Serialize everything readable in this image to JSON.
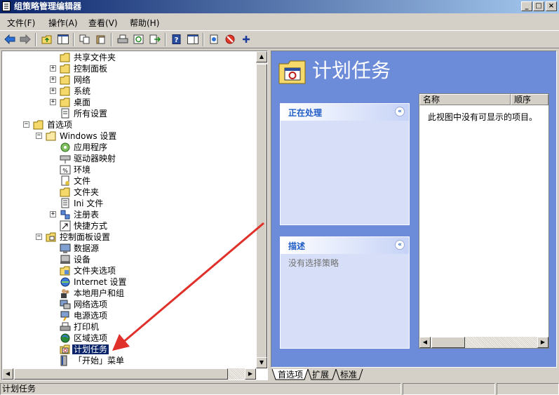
{
  "window": {
    "title": "组策略管理编辑器",
    "min_glyph": "_",
    "max_glyph": "□",
    "close_glyph": "×"
  },
  "menu": [
    {
      "label": "文件(F)"
    },
    {
      "label": "操作(A)"
    },
    {
      "label": "查看(V)"
    },
    {
      "label": "帮助(H)"
    }
  ],
  "tree": [
    {
      "label": "共享文件夹",
      "icon": "folder-icon",
      "expander": ""
    },
    {
      "label": "控制面板",
      "icon": "folder-icon",
      "expander": "+"
    },
    {
      "label": "网络",
      "icon": "folder-icon",
      "expander": "+"
    },
    {
      "label": "系统",
      "icon": "folder-icon",
      "expander": "+"
    },
    {
      "label": "桌面",
      "icon": "folder-icon",
      "expander": "+"
    },
    {
      "label": "所有设置",
      "icon": "settings-list-icon",
      "expander": ""
    },
    {
      "label": "首选项",
      "icon": "folder-icon",
      "expander": "−"
    },
    {
      "label": "Windows 设置",
      "icon": "folder-open-icon",
      "expander": "−"
    },
    {
      "label": "应用程序",
      "icon": "application-icon",
      "expander": ""
    },
    {
      "label": "驱动器映射",
      "icon": "drive-map-icon",
      "expander": ""
    },
    {
      "label": "环境",
      "icon": "environment-icon",
      "expander": ""
    },
    {
      "label": "文件",
      "icon": "file-icon",
      "expander": ""
    },
    {
      "label": "文件夹",
      "icon": "folder-icon",
      "expander": ""
    },
    {
      "label": "Ini 文件",
      "icon": "ini-file-icon",
      "expander": ""
    },
    {
      "label": "注册表",
      "icon": "registry-icon",
      "expander": "+"
    },
    {
      "label": "快捷方式",
      "icon": "shortcut-icon",
      "expander": ""
    },
    {
      "label": "控制面板设置",
      "icon": "control-panel-folder-icon",
      "expander": "−"
    },
    {
      "label": "数据源",
      "icon": "data-source-icon",
      "expander": ""
    },
    {
      "label": "设备",
      "icon": "device-icon",
      "expander": ""
    },
    {
      "label": "文件夹选项",
      "icon": "folder-options-icon",
      "expander": ""
    },
    {
      "label": "Internet 设置",
      "icon": "internet-icon",
      "expander": ""
    },
    {
      "label": "本地用户和组",
      "icon": "users-icon",
      "expander": ""
    },
    {
      "label": "网络选项",
      "icon": "network-icon",
      "expander": ""
    },
    {
      "label": "电源选项",
      "icon": "power-icon",
      "expander": ""
    },
    {
      "label": "打印机",
      "icon": "printer-icon",
      "expander": ""
    },
    {
      "label": "区域选项",
      "icon": "globe-icon",
      "expander": ""
    },
    {
      "label": "计划任务",
      "icon": "scheduled-tasks-icon",
      "expander": "",
      "selected": true
    },
    {
      "label": "「开始」菜单",
      "icon": "start-menu-icon",
      "expander": ""
    }
  ],
  "details": {
    "title": "计划任务",
    "panel_processing_title": "正在处理",
    "panel_description_title": "描述",
    "panel_description_body": "没有选择策略",
    "columns": [
      "名称",
      "顺序"
    ],
    "empty_message": "此视图中没有可显示的项目。",
    "collapse_glyph": "«"
  },
  "tabs": [
    "首选项",
    "扩展",
    "标准"
  ],
  "status": {
    "text": "计划任务"
  },
  "accent_colors": {
    "selection": "#0a246a",
    "pane_background": "#6c8bd9",
    "annotation_arrow": "#e0302a"
  }
}
